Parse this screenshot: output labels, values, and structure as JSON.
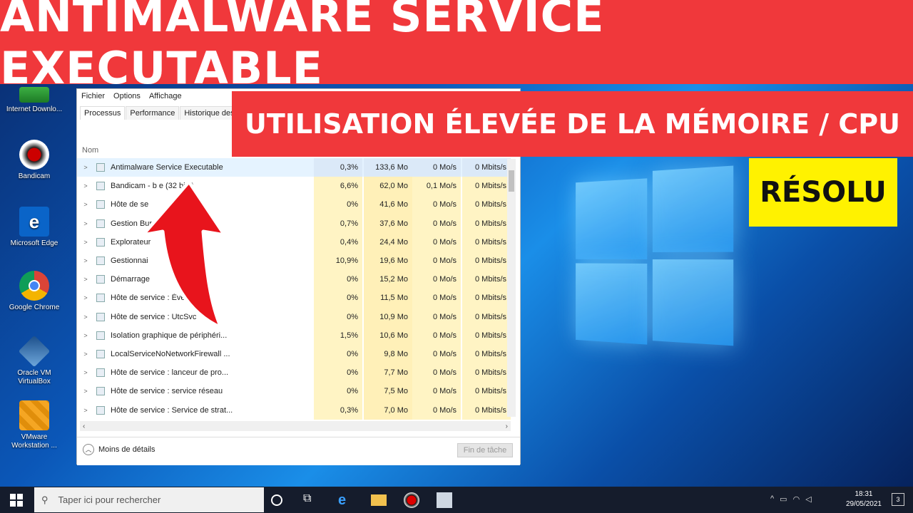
{
  "banner": {
    "title": "ANTIMALWARE SERVICE EXECUTABLE",
    "subtitle": "UTILISATION ÉLEVÉE DE LA MÉMOIRE / CPU",
    "badge": "RÉSOLU"
  },
  "desktop_icons": [
    {
      "label": "Internet Downlo...",
      "icon": "internet-download-manager-icon"
    },
    {
      "label": "Bandicam",
      "icon": "bandicam-icon"
    },
    {
      "label": "Microsoft Edge",
      "icon": "edge-icon"
    },
    {
      "label": "Google Chrome",
      "icon": "chrome-icon"
    },
    {
      "label": "Oracle VM VirtualBox",
      "icon": "virtualbox-icon"
    },
    {
      "label": "VMware Workstation ...",
      "icon": "vmware-icon"
    }
  ],
  "task_manager": {
    "menu": [
      "Fichier",
      "Options",
      "Affichage"
    ],
    "tabs": [
      "Processus",
      "Performance",
      "Historique des a"
    ],
    "column_name": "Nom",
    "rows": [
      {
        "name": "Antimalware Service Executable",
        "cpu": "0,3%",
        "mem": "133,6 Mo",
        "disk": "0 Mo/s",
        "net": "0 Mbits/s"
      },
      {
        "name": "Bandicam - b          e (32 bits)",
        "cpu": "6,6%",
        "mem": "62,0 Mo",
        "disk": "0,1 Mo/s",
        "net": "0 Mbits/s"
      },
      {
        "name": "Hôte de se",
        "cpu": "0%",
        "mem": "41,6 Mo",
        "disk": "0 Mo/s",
        "net": "0 Mbits/s"
      },
      {
        "name": "Gestion                          Bur...",
        "cpu": "0,7%",
        "mem": "37,6 Mo",
        "disk": "0 Mo/s",
        "net": "0 Mbits/s"
      },
      {
        "name": "Explorateur",
        "cpu": "0,4%",
        "mem": "24,4 Mo",
        "disk": "0 Mo/s",
        "net": "0 Mbits/s"
      },
      {
        "name": "Gestionnai",
        "cpu": "10,9%",
        "mem": "19,6 Mo",
        "disk": "0 Mo/s",
        "net": "0 Mbits/s"
      },
      {
        "name": "Démarrage",
        "cpu": "0%",
        "mem": "15,2 Mo",
        "disk": "0 Mo/s",
        "net": "0 Mbits/s"
      },
      {
        "name": "Hôte de service :       Évén...",
        "cpu": "0%",
        "mem": "11,5 Mo",
        "disk": "0 Mo/s",
        "net": "0 Mbits/s"
      },
      {
        "name": "Hôte de service : UtcSvc",
        "cpu": "0%",
        "mem": "10,9 Mo",
        "disk": "0 Mo/s",
        "net": "0 Mbits/s"
      },
      {
        "name": "Isolation graphique de périphéri...",
        "cpu": "1,5%",
        "mem": "10,6 Mo",
        "disk": "0 Mo/s",
        "net": "0 Mbits/s"
      },
      {
        "name": "LocalServiceNoNetworkFirewall ...",
        "cpu": "0%",
        "mem": "9,8 Mo",
        "disk": "0 Mo/s",
        "net": "0 Mbits/s"
      },
      {
        "name": "Hôte de service : lanceur de pro...",
        "cpu": "0%",
        "mem": "7,7 Mo",
        "disk": "0 Mo/s",
        "net": "0 Mbits/s"
      },
      {
        "name": "Hôte de service : service réseau",
        "cpu": "0%",
        "mem": "7,5 Mo",
        "disk": "0 Mo/s",
        "net": "0 Mbits/s"
      },
      {
        "name": "Hôte de service : Service de strat...",
        "cpu": "0,3%",
        "mem": "7,0 Mo",
        "disk": "0 Mo/s",
        "net": "0 Mbits/s"
      }
    ],
    "less_details": "Moins de détails",
    "end_task": "Fin de tâche"
  },
  "taskbar": {
    "search_placeholder": "Taper ici pour rechercher",
    "time": "18:31",
    "date": "29/05/2021",
    "notification_count": "3"
  },
  "colors": {
    "banner_red": "#f0383b",
    "badge_yellow": "#fff200",
    "cpu_highlight": "#fff4c4"
  }
}
